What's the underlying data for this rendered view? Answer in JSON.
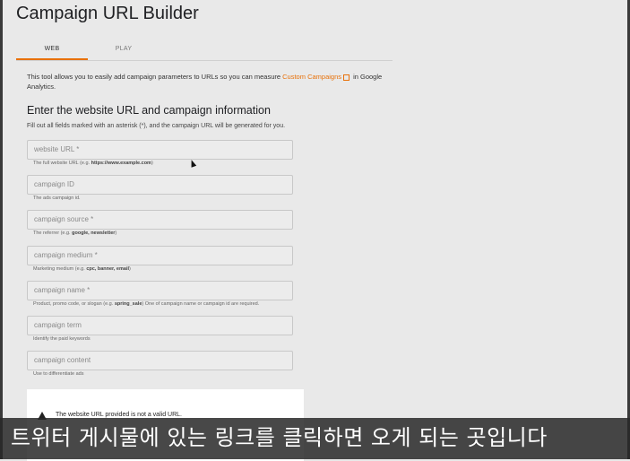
{
  "page": {
    "title": "Campaign URL Builder"
  },
  "tabs": [
    {
      "label": "WEB",
      "active": true
    },
    {
      "label": "PLAY",
      "active": false
    }
  ],
  "intro": {
    "text_before": "This tool allows you to easily add campaign parameters to URLs so you can measure ",
    "link_text": "Custom Campaigns",
    "text_after": " in Google Analytics."
  },
  "section": {
    "title": "Enter the website URL and campaign information",
    "subtitle": "Fill out all fields marked with an asterisk (*), and the campaign URL will be generated for you."
  },
  "fields": [
    {
      "placeholder": "website URL *",
      "hint_prefix": "The full website URL (e.g. ",
      "hint_bold": "https://www.example.com",
      "hint_suffix": ")"
    },
    {
      "placeholder": "campaign ID",
      "hint_prefix": "The ads campaign id.",
      "hint_bold": "",
      "hint_suffix": ""
    },
    {
      "placeholder": "campaign source *",
      "hint_prefix": "The referrer (e.g. ",
      "hint_bold": "google, newsletter",
      "hint_suffix": ")"
    },
    {
      "placeholder": "campaign medium *",
      "hint_prefix": "Marketing medium (e.g. ",
      "hint_bold": "cpc, banner, email",
      "hint_suffix": ")"
    },
    {
      "placeholder": "campaign name *",
      "hint_prefix": "Product, promo code, or slogan (e.g. ",
      "hint_bold": "spring_sale",
      "hint_suffix": ") One of campaign name or campaign id are required."
    },
    {
      "placeholder": "campaign term",
      "hint_prefix": "Identify the paid keywords",
      "hint_bold": "",
      "hint_suffix": ""
    },
    {
      "placeholder": "campaign content",
      "hint_prefix": "Use to differentiate ads",
      "hint_bold": "",
      "hint_suffix": ""
    }
  ],
  "warning": {
    "text": "The website URL provided is not a valid URL."
  },
  "subtitle_caption": "트위터 게시물에 있는 링크를 클릭하면 오게 되는 곳입니다",
  "colors": {
    "accent": "#e8710a"
  }
}
